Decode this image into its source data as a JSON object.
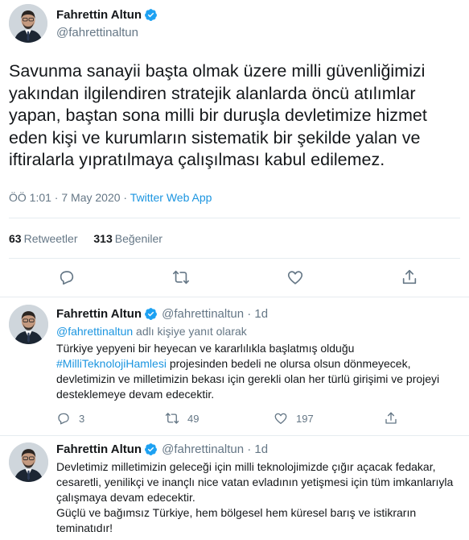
{
  "main_tweet": {
    "name": "Fahrettin Altun",
    "handle": "@fahrettinaltun",
    "text": "Savunma sanayii başta olmak üzere milli güvenliğimizi\nyakından ilgilendiren stratejik alanlarda öncü atılımlar\nyapan, baştan sona milli bir duruşla devletimize hizmet\neden kişi ve kurumların sistematik bir şekilde yalan ve\niftiralarla yıpratılmaya çalışılması kabul edilemez.",
    "timestamp": "ÖÖ 1:01 · 7 May 2020 · ",
    "source": "Twitter Web App",
    "retweets_count": "63",
    "retweets_label": "Retweetler",
    "likes_count": "313",
    "likes_label": "Beğeniler"
  },
  "replies": [
    {
      "name": "Fahrettin Altun",
      "handle": "@fahrettinaltun · 1d",
      "reply_to_handle": "@fahrettinaltun",
      "reply_to_suffix": " adlı kişiye yanıt olarak",
      "text_before": "Türkiye yepyeni bir heyecan ve kararlılıkla başlatmış olduğu",
      "hashtag": "#MilliTeknolojiHamlesi",
      "text_after": " projesinden bedeli ne olursa olsun dönmeyecek, devletimizin ve milletimizin bekası için gerekli olan her türlü girişimi ve projeyi desteklemeye devam edecektir.",
      "replies_count": "3",
      "retweets_count": "49",
      "likes_count": "197"
    },
    {
      "name": "Fahrettin Altun",
      "handle": "@fahrettinaltun · 1d",
      "text_line1": "Devletimiz milletimizin geleceği için milli teknolojimizde çığır açacak fedakar, cesaretli, yenilikçi ve inançlı nice vatan evladının yetişmesi için tüm imkanlarıyla çalışmaya devam edecektir.",
      "text_line2": "Güçlü ve bağımsız Türkiye, hem bölgesel hem küresel barış ve istikrarın teminatıdır!"
    }
  ],
  "icons": [
    "verified-badge-icon",
    "reply-icon",
    "retweet-icon",
    "like-icon",
    "share-icon"
  ],
  "colors": {
    "link": "#1b95e0",
    "secondary_text": "#657786",
    "border": "#e6ecf0",
    "verified": "#1da1f2"
  }
}
